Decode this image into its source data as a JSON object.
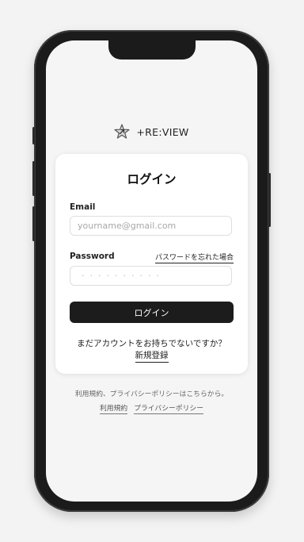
{
  "app": {
    "logo_text": "+RE:VIEW",
    "logo_icon": "star-arrow-icon"
  },
  "login_card": {
    "title": "ログイン",
    "email_label": "Email",
    "email_placeholder": "yourname@gmail.com",
    "password_label": "Password",
    "forgot_password": "パスワードを忘れた場合",
    "password_value": "··········",
    "login_button": "ログイン",
    "no_account_prompt": "まだアカウントをお持ちでないですか？",
    "register_link": "新規登録"
  },
  "footer": {
    "terms_text": "利用規約、プライバシーポリシーはこちらから。",
    "terms_link": "利用規約",
    "privacy_link": "プライバシーポリシー"
  },
  "colors": {
    "primary_button": "#1c1c1c",
    "background": "#f5f5f5",
    "card": "#ffffff"
  }
}
